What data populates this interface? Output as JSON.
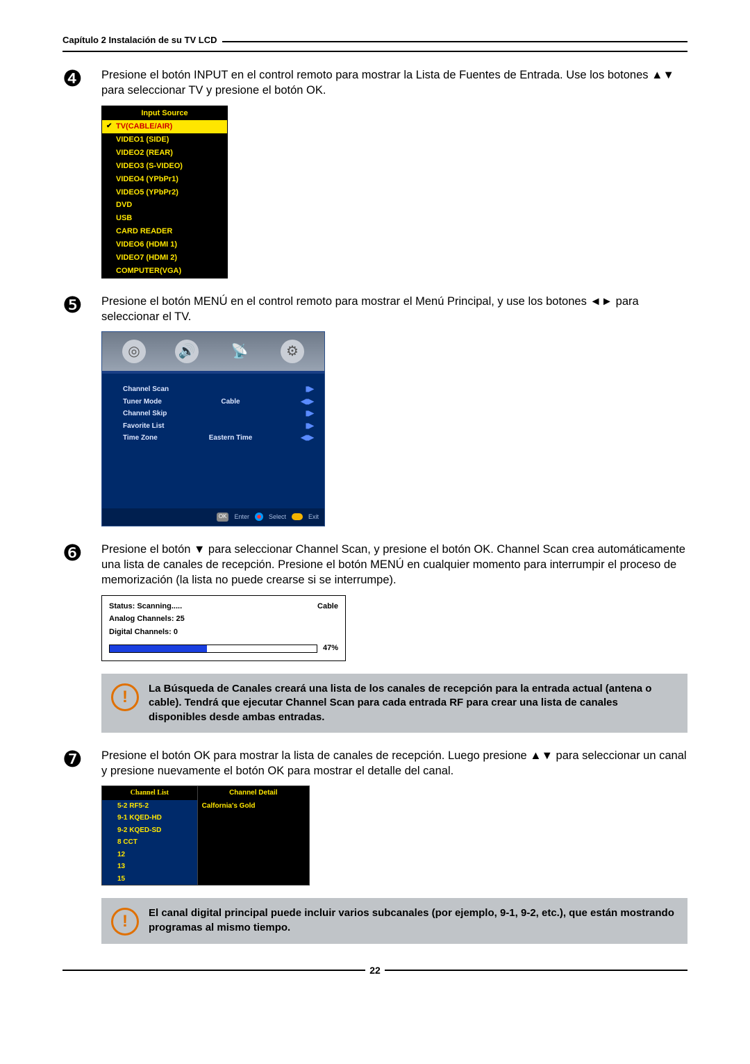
{
  "chapter_title": "Capítulo 2 Instalación de su TV LCD",
  "step4": {
    "text": "Presione el botón INPUT en el control remoto para mostrar la Lista de Fuentes de Entrada. Use los botones ▲▼ para seleccionar TV y presione el botón OK.",
    "menu_title": "Input Source",
    "items": [
      "TV(CABLE/AIR)",
      "VIDEO1 (SIDE)",
      "VIDEO2 (REAR)",
      "VIDEO3 (S-VIDEO)",
      "VIDEO4 (YPbPr1)",
      "VIDEO5 (YPbPr2)",
      "DVD",
      "USB",
      "CARD READER",
      "VIDEO6 (HDMI 1)",
      "VIDEO7 (HDMI 2)",
      "COMPUTER(VGA)"
    ]
  },
  "step5": {
    "text": "Presione el botón MENÚ en el control remoto para mostrar el Menú Principal, y use los botones ◄► para seleccionar el TV.",
    "menu": {
      "rows": [
        {
          "label": "Channel Scan",
          "value": "",
          "arrows": "▮▶"
        },
        {
          "label": "Tuner Mode",
          "value": "Cable",
          "arrows": "◀▮▶"
        },
        {
          "label": "Channel Skip",
          "value": "",
          "arrows": "▮▶"
        },
        {
          "label": "Favorite List",
          "value": "",
          "arrows": "▮▶"
        },
        {
          "label": "Time Zone",
          "value": "Eastern Time",
          "arrows": "◀▮▶"
        }
      ],
      "footer": {
        "enter": "Enter",
        "select": "Select",
        "exit": "Exit",
        "ok": "OK"
      }
    }
  },
  "step6": {
    "text": "Presione el botón ▼ para seleccionar Channel Scan, y presione el botón OK. Channel Scan crea automáticamente una lista de canales de recepción. Presione el botón MENÚ en cualquier momento para interrumpir el proceso de memorización (la lista no puede crearse si se interrumpe).",
    "scan": {
      "status": "Status: Scanning.....",
      "mode": "Cable",
      "analog": "Analog Channels: 25",
      "digital": "Digital Channels: 0",
      "percent": "47%"
    },
    "callout": "La Búsqueda de Canales creará una lista de los canales de recepción para la entrada actual (antena o cable). Tendrá que ejecutar Channel Scan para cada entrada RF para crear una lista de canales disponibles desde ambas entradas."
  },
  "step7": {
    "text": "Presione el botón OK para mostrar la lista de canales de recepción. Luego presione ▲▼ para seleccionar un canal y presione nuevamente el botón OK para mostrar el detalle del canal.",
    "channel_list_header": "Channel List",
    "channel_detail_header": "Channel Detail",
    "channel_list": [
      "5-2 RF5-2",
      "9-1 KQED-HD",
      "9-2 KQED-SD",
      " 8    CCT",
      "12",
      "13",
      "15"
    ],
    "channel_detail": [
      "Calfornia's Gold"
    ],
    "callout": "El canal digital principal puede incluir varios subcanales (por ejemplo, 9-1, 9-2, etc.), que están mostrando programas al mismo tiempo."
  },
  "page_number": "22"
}
